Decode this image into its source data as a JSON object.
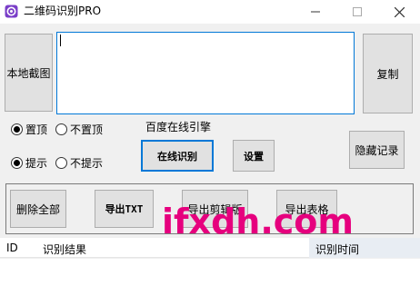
{
  "window": {
    "title": "二维码识别PRO",
    "controls": [
      "minimize",
      "maximize",
      "close"
    ]
  },
  "buttons": {
    "local_capture": "本地截图",
    "copy": "复制",
    "online_recognize": "在线识别",
    "settings": "设置",
    "hide_records": "隐藏记录",
    "delete_all": "删除全部",
    "export_txt": "导出TXT",
    "export_clipboard": "导出剪辑版",
    "export_table": "导出表格"
  },
  "result_text": "",
  "options": {
    "pin_top": {
      "label": "置顶",
      "checked": true
    },
    "no_pin_top": {
      "label": "不置顶",
      "checked": false
    },
    "notify": {
      "label": "提示",
      "checked": true
    },
    "no_notify": {
      "label": "不提示",
      "checked": false
    }
  },
  "engine_group_label": "百度在线引擎",
  "table": {
    "columns": [
      "ID",
      "识别结果",
      "识别时间"
    ],
    "rows": []
  },
  "watermark": "ifxdh.com",
  "colors": {
    "accent": "#0078d7",
    "watermark": "#e6007e",
    "icon": "#7a3ec8"
  }
}
